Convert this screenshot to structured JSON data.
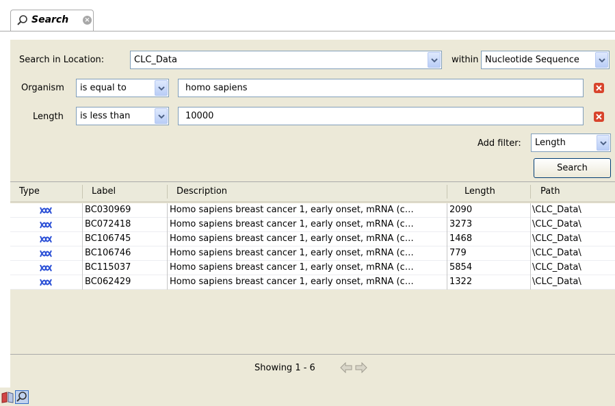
{
  "tab": {
    "title": "Search",
    "icon": "search-icon"
  },
  "search_location": {
    "label": "Search in Location:",
    "value": "CLC_Data",
    "within_label": "within",
    "within_value": "Nucleotide Sequence"
  },
  "filters": [
    {
      "field": "Organism",
      "operator": "is equal to",
      "value": "homo sapiens"
    },
    {
      "field": "Length",
      "operator": "is less than",
      "value": "10000"
    }
  ],
  "add_filter": {
    "label": "Add filter:",
    "value": "Length"
  },
  "search_button": "Search",
  "table": {
    "columns": [
      "Type",
      "Label",
      "Description",
      "Length",
      "Path"
    ],
    "rows": [
      {
        "type_icon": "nucleotide-sequence-icon",
        "label": "BC030969",
        "description": "Homo sapiens breast cancer 1, early onset, mRNA (c…",
        "length": "2090",
        "path": "\\CLC_Data\\"
      },
      {
        "type_icon": "nucleotide-sequence-icon",
        "label": "BC072418",
        "description": "Homo sapiens breast cancer 1, early onset, mRNA (c…",
        "length": "3273",
        "path": "\\CLC_Data\\"
      },
      {
        "type_icon": "nucleotide-sequence-icon",
        "label": "BC106745",
        "description": "Homo sapiens breast cancer 1, early onset, mRNA (c…",
        "length": "1468",
        "path": "\\CLC_Data\\"
      },
      {
        "type_icon": "nucleotide-sequence-icon",
        "label": "BC106746",
        "description": "Homo sapiens breast cancer 1, early onset, mRNA (c…",
        "length": "779",
        "path": "\\CLC_Data\\"
      },
      {
        "type_icon": "nucleotide-sequence-icon",
        "label": "BC115037",
        "description": "Homo sapiens breast cancer 1, early onset, mRNA (c…",
        "length": "5854",
        "path": "\\CLC_Data\\"
      },
      {
        "type_icon": "nucleotide-sequence-icon",
        "label": "BC062429",
        "description": "Homo sapiens breast cancer 1, early onset, mRNA (c…",
        "length": "1322",
        "path": "\\CLC_Data\\"
      }
    ]
  },
  "footer": {
    "showing": "Showing 1 - 6"
  },
  "bottom_bar": {
    "icons": [
      "book-icon",
      "search-icon"
    ]
  },
  "colors": {
    "panel_bg": "#ece9d8",
    "remove_red": "#d8442c",
    "sequence_blue": "#2a4fd6"
  }
}
